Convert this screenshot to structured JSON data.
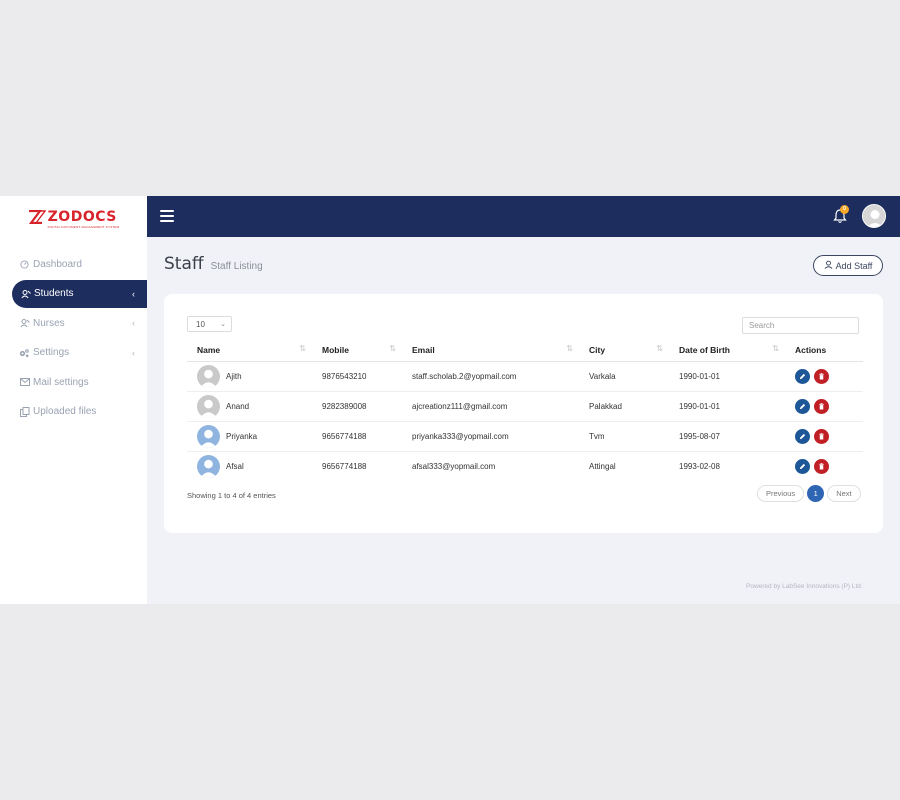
{
  "brand": {
    "name": "ZODOCS",
    "tagline": "DIGITAL DOCUMENT MANAGEMENT SYSTEM",
    "color": "#d8232a"
  },
  "sidebar": {
    "items": [
      {
        "label": "Dashboard",
        "icon": "dashboard-icon",
        "active": false,
        "chevron": false
      },
      {
        "label": "Students",
        "icon": "students-icon",
        "active": true,
        "chevron": true
      },
      {
        "label": "Nurses",
        "icon": "nurses-icon",
        "active": false,
        "chevron": true
      },
      {
        "label": "Settings",
        "icon": "gears-icon",
        "active": false,
        "chevron": true
      },
      {
        "label": "Mail settings",
        "icon": "mail-icon",
        "active": false,
        "chevron": false
      },
      {
        "label": "Uploaded files",
        "icon": "files-icon",
        "active": false,
        "chevron": false
      }
    ]
  },
  "topbar": {
    "notification_count": "0",
    "bg_color": "#1c2d5e"
  },
  "page": {
    "title": "Staff",
    "subtitle": "Staff Listing",
    "add_label": "Add Staff"
  },
  "table": {
    "page_length": "10",
    "search_placeholder": "Search",
    "columns": [
      "Name",
      "Mobile",
      "Email",
      "City",
      "Date of Birth",
      "Actions"
    ],
    "rows": [
      {
        "name": "Ajith",
        "mobile": "9876543210",
        "email": "staff.scholab.2@yopmail.com",
        "city": "Varkala",
        "dob": "1990-01-01",
        "avatar": "grey"
      },
      {
        "name": "Anand",
        "mobile": "9282389008",
        "email": "ajcreationz111@gmail.com",
        "city": "Palakkad",
        "dob": "1990-01-01",
        "avatar": "grey"
      },
      {
        "name": "Priyanka",
        "mobile": "9656774188",
        "email": "priyanka333@yopmail.com",
        "city": "Tvm",
        "dob": "1995-08-07",
        "avatar": "blue"
      },
      {
        "name": "Afsal",
        "mobile": "9656774188",
        "email": "afsal333@yopmail.com",
        "city": "Attingal",
        "dob": "1993-02-08",
        "avatar": "blue"
      }
    ],
    "info": "Showing 1 to 4 of 4 entries",
    "pagination": {
      "previous": "Previous",
      "current": "1",
      "next": "Next"
    }
  },
  "footer": {
    "text": "Powered by LabSee Innovations (P) Ltd."
  }
}
